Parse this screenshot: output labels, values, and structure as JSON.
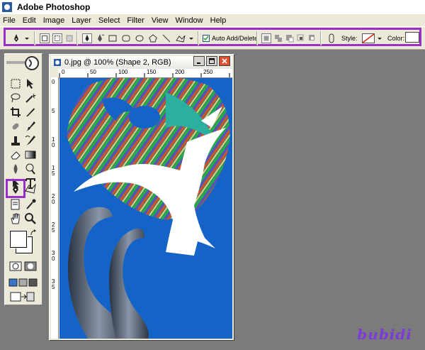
{
  "app": {
    "title": "Adobe Photoshop"
  },
  "menu": [
    "File",
    "Edit",
    "Image",
    "Layer",
    "Select",
    "Filter",
    "View",
    "Window",
    "Help"
  ],
  "options": {
    "auto_add_delete_label": "Auto Add/Delete",
    "auto_add_delete_checked": true,
    "style_label": "Style:",
    "color_label": "Color:"
  },
  "document": {
    "title": "0.jpg @ 100% (Shape 2, RGB)",
    "ruler_top": [
      "0",
      "50",
      "100",
      "150",
      "200",
      "250"
    ],
    "ruler_left": [
      "0",
      "5",
      "1 0",
      "1 5",
      "2 0",
      "2 5",
      "3 0",
      "3 5"
    ]
  },
  "watermark": "bubidi",
  "colors": {
    "highlight": "#9b30c8",
    "canvas_blue": "#1464c8"
  }
}
